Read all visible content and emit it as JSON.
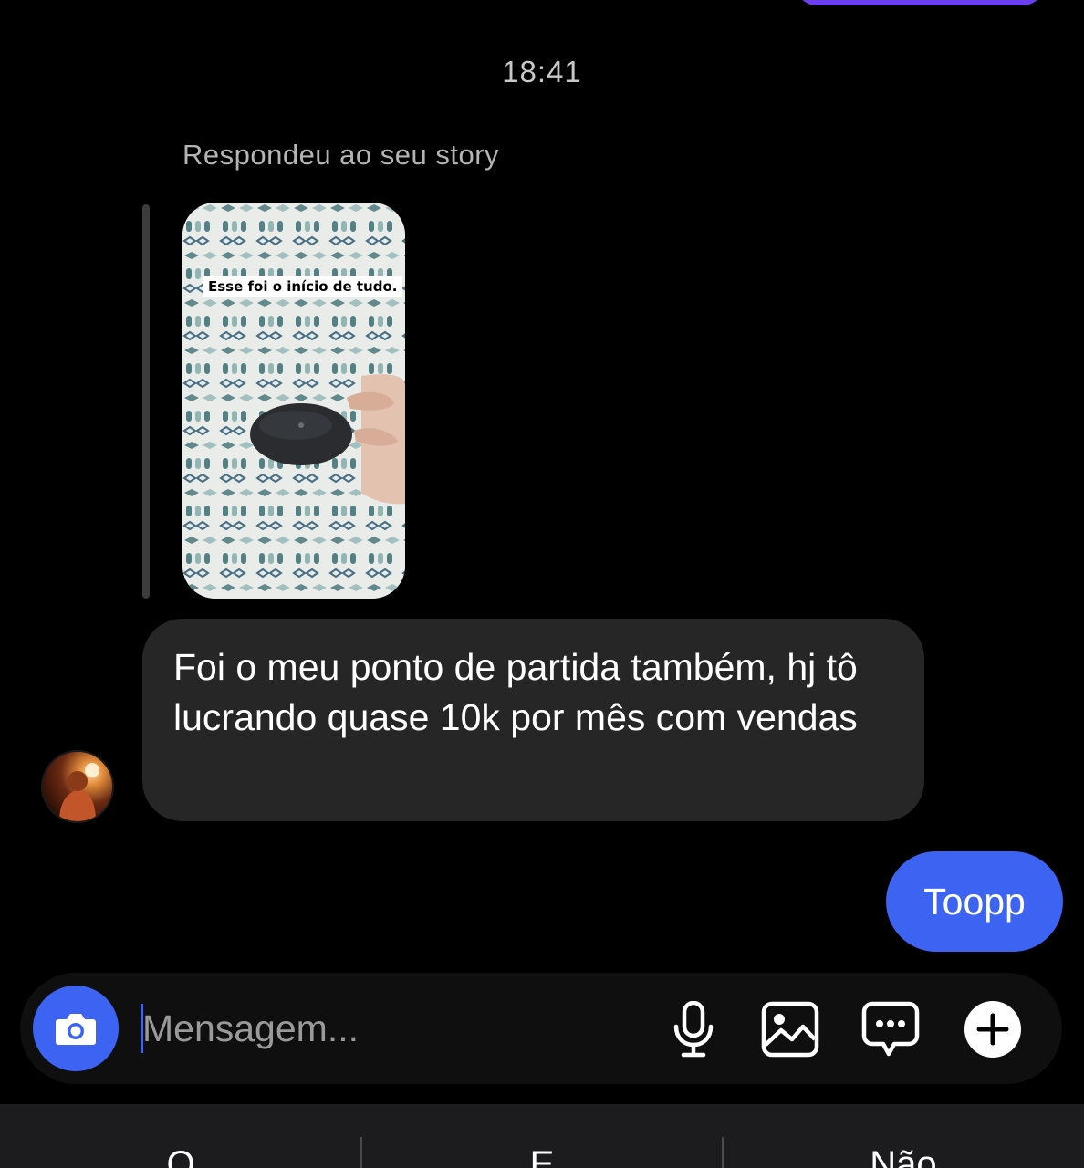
{
  "conversation": {
    "timestamp": "18:41",
    "reply_context": "Respondeu ao seu story",
    "story": {
      "caption": "Esse foi o início de tudo."
    },
    "received_message": "Foi o meu ponto de partida também, hj tô lucrando quase 10k por mês com vendas",
    "sent_message": "Toopp"
  },
  "composer": {
    "placeholder": "Mensagem...",
    "icons": [
      "camera-icon",
      "microphone-icon",
      "gallery-icon",
      "sticker-icon",
      "plus-icon"
    ]
  },
  "keyboard": {
    "suggestions": [
      "O",
      "E",
      "Não"
    ]
  },
  "colors": {
    "background": "#000000",
    "received_bubble": "#262626",
    "sent_bubble": "#3d63f2",
    "accent": "#3d63f2"
  }
}
